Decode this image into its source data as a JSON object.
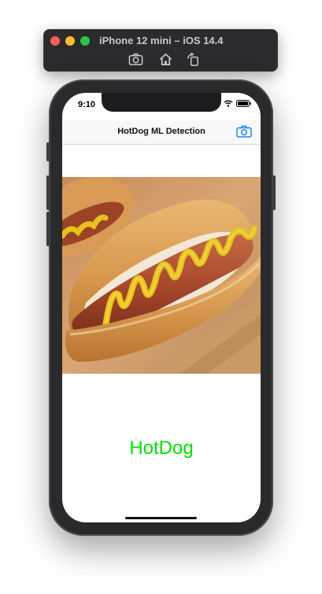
{
  "simulator": {
    "title": "iPhone 12 mini – iOS 14.4",
    "buttons": [
      {
        "name": "screenshot",
        "icon": "camera-icon"
      },
      {
        "name": "home",
        "icon": "home-icon"
      },
      {
        "name": "rotate",
        "icon": "rotate-icon"
      }
    ]
  },
  "status_bar": {
    "time": "9:10"
  },
  "navbar": {
    "title": "HotDog ML Detection",
    "right_button_icon": "camera-icon"
  },
  "content": {
    "image_subject": "hot dog with mustard",
    "result_label": "HotDog",
    "result_color": "#00e000"
  },
  "colors": {
    "accent": "#0a84ff"
  }
}
